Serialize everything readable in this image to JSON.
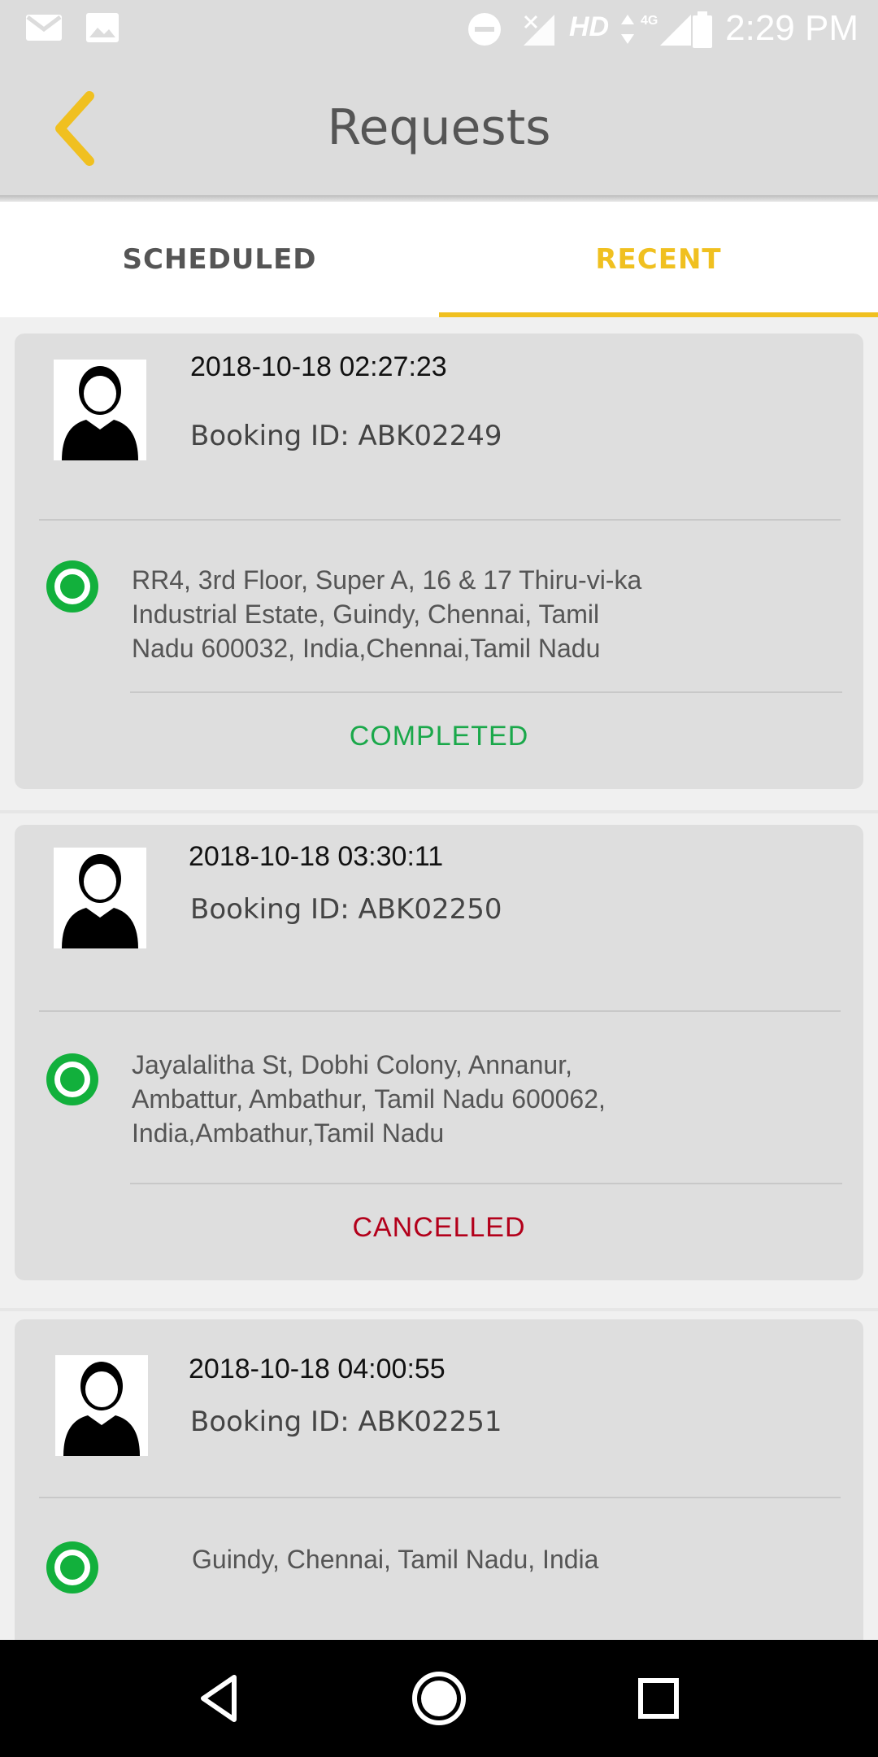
{
  "status_bar": {
    "time": "2:29 PM",
    "network_label": "HD",
    "signal_label": "4G",
    "icons": [
      "gmail-icon",
      "image-icon",
      "do-not-disturb-icon",
      "no-signal-icon",
      "signal-4g-icon",
      "battery-icon"
    ]
  },
  "app_bar": {
    "title": "Requests",
    "back_icon": "back-chevron-icon",
    "accent": "#f0c020"
  },
  "tabs": [
    {
      "label": "SCHEDULED",
      "active": false
    },
    {
      "label": "RECENT",
      "active": true
    }
  ],
  "requests": [
    {
      "datetime": "2018-10-18 02:27:23",
      "booking_id": "Booking ID: ABK02249",
      "address_lines": [
        "RR4, 3rd Floor, Super A, 16 & 17 Thiru-vi-ka",
        "Industrial Estate, Guindy, Chennai, Tamil",
        "Nadu 600032, India,Chennai,Tamil Nadu"
      ],
      "status": "COMPLETED",
      "status_color": "#1aa84a"
    },
    {
      "datetime": "2018-10-18  03:30:11",
      "booking_id": "Booking ID: ABK02250",
      "address_lines": [
        "Jayalalitha St, Dobhi Colony, Annanur,",
        "Ambattur, Ambathur, Tamil Nadu 600062,",
        "India,Ambathur,Tamil Nadu"
      ],
      "status": "CANCELLED",
      "status_color": "#b3001b"
    },
    {
      "datetime": "2018-10-18  04:00:55",
      "booking_id": "Booking ID: ABK02251",
      "address_lines": [
        "Guindy, Chennai, Tamil Nadu, India"
      ],
      "status": "",
      "status_color": ""
    }
  ],
  "nav_bar": {
    "icons": [
      "back-triangle-icon",
      "home-circle-icon",
      "recents-square-icon"
    ]
  },
  "colors": {
    "location_green": "#12b03c",
    "completed": "#1aa84a",
    "cancelled": "#b3001b"
  }
}
